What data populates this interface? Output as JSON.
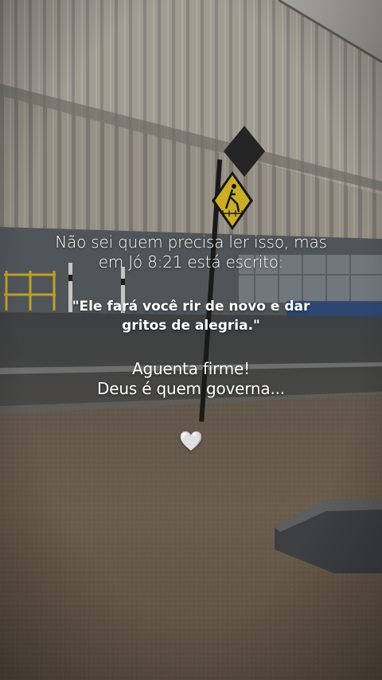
{
  "post": {
    "intro_line_1": "Não sei quem precisa ler isso, mas",
    "intro_line_2": "em Jó 8:21 está escrito:",
    "verse_line_1": "\"Ele fará você rir de novo e dar",
    "verse_line_2": "gritos de alegria.\"",
    "encourage_line_1": "Aguenta firme!",
    "encourage_line_2": "Deus é quem governa...",
    "heart_glyph": "🤍",
    "heart_icon": "white-heart-icon"
  },
  "colors": {
    "text": "#ffffff",
    "sign_yellow": "#e8c62c",
    "building": "#b4ada3",
    "grass": "#7a6a58",
    "road": "#4a4b4e"
  }
}
